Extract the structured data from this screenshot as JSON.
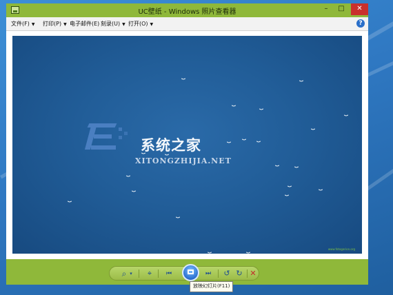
{
  "window": {
    "title": "UC壁纸 - Windows 照片查看器",
    "minimize_label": "–",
    "maximize_label": "□",
    "close_label": "✕"
  },
  "menubar": {
    "items": [
      {
        "label": "文件(F)"
      },
      {
        "label": "打印(P)"
      },
      {
        "label": "电子邮件(E)"
      },
      {
        "label": "刻录(U)"
      },
      {
        "label": "打开(O)"
      }
    ],
    "help_label": "?"
  },
  "photo": {
    "watermark_title": "系统之家",
    "watermark_pinyin": "XITONGZHIJIA.NET",
    "credit": "www.fotogarion.org"
  },
  "controls": {
    "zoom_label": "⌕",
    "zoom_caret": "▾",
    "actual_size_label": "⌖",
    "previous_label": "⏮",
    "next_label": "⏭",
    "rotate_ccw_label": "↺",
    "rotate_cw_label": "↻",
    "delete_label": "✕",
    "tooltip": "放映幻灯片(F11)"
  },
  "colors": {
    "window_accent": "#8fb83a",
    "close_button": "#c9302c",
    "desktop": "#2f78c2"
  }
}
